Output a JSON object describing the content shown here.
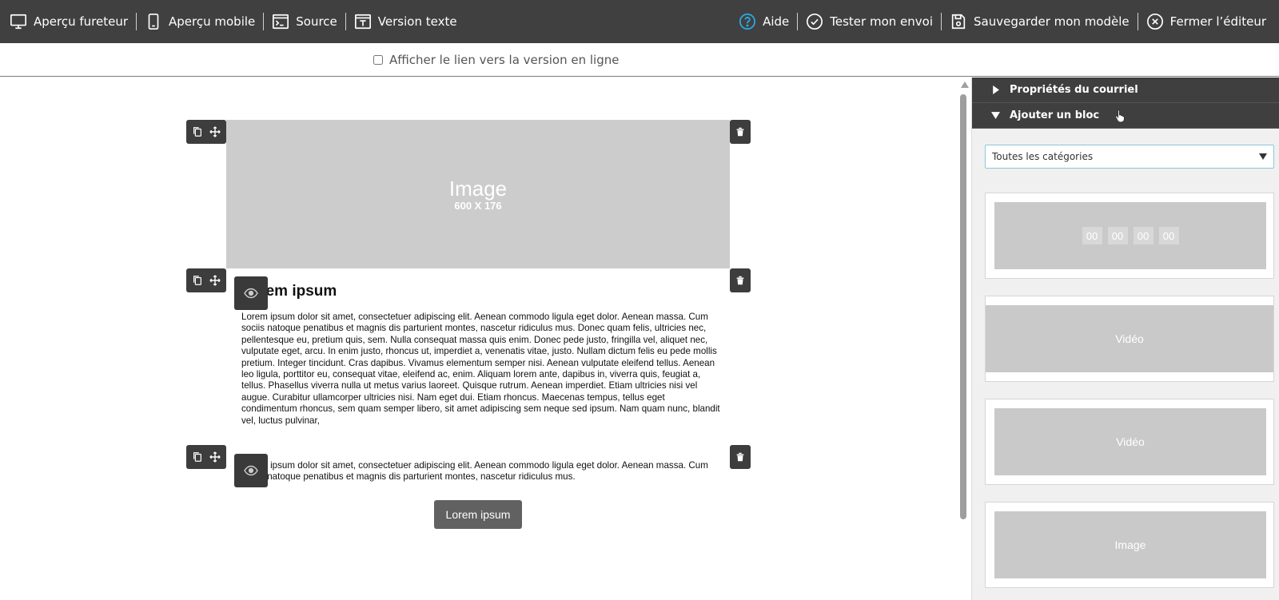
{
  "toolbar": {
    "left": [
      {
        "label": "Aperçu fureteur",
        "icon": "monitor-icon"
      },
      {
        "label": "Aperçu mobile",
        "icon": "mobile-icon"
      },
      {
        "label": "Source",
        "icon": "source-code-icon"
      },
      {
        "label": "Version texte",
        "icon": "text-version-icon"
      }
    ],
    "right": [
      {
        "label": "Aide",
        "icon": "help-icon",
        "icon_color": "#2aa8e0"
      },
      {
        "label": "Tester mon envoi",
        "icon": "check-circle-icon"
      },
      {
        "label": "Sauvegarder mon modèle",
        "icon": "save-icon"
      },
      {
        "label": "Fermer l’éditeur",
        "icon": "close-circle-icon"
      }
    ]
  },
  "subbar": {
    "online_link_label": "Afficher le lien vers la version en ligne",
    "online_link_checked": false
  },
  "editor": {
    "image_block": {
      "title": "Image",
      "size": "600 X 176"
    },
    "text_block": {
      "title": "Lorem ipsum",
      "body": "Lorem ipsum dolor sit amet, consectetuer adipiscing elit. Aenean commodo ligula eget dolor. Aenean massa. Cum sociis natoque penatibus et magnis dis parturient montes, nascetur ridiculus mus. Donec quam felis, ultricies nec, pellentesque eu, pretium quis, sem. Nulla consequat massa quis enim. Donec pede justo, fringilla vel, aliquet nec, vulputate eget, arcu. In enim justo, rhoncus ut, imperdiet a, venenatis vitae, justo. Nullam dictum felis eu pede mollis pretium. Integer tincidunt. Cras dapibus. Vivamus elementum semper nisi. Aenean vulputate eleifend tellus. Aenean leo ligula, porttitor eu, consequat vitae, eleifend ac, enim. Aliquam lorem ante, dapibus in, viverra quis, feugiat a, tellus. Phasellus viverra nulla ut metus varius laoreet. Quisque rutrum. Aenean imperdiet. Etiam ultricies nisi vel augue. Curabitur ullamcorper ultricies nisi. Nam eget dui. Etiam rhoncus. Maecenas tempus, tellus eget condimentum rhoncus, sem quam semper libero, sit amet adipiscing sem neque sed ipsum. Nam quam nunc, blandit vel, luctus pulvinar,"
    },
    "button_block": {
      "body": "Lorem ipsum dolor sit amet, consectetuer adipiscing elit. Aenean commodo ligula eget dolor. Aenean massa. Cum sociis natoque penatibus et magnis dis parturient montes, nascetur ridiculus mus.",
      "button_label": "Lorem ipsum"
    }
  },
  "panel": {
    "sections": [
      {
        "label": "Propriétés du courriel",
        "expanded": false
      },
      {
        "label": "Ajouter un bloc",
        "expanded": true
      }
    ],
    "category_select": {
      "value": "Toutes les catégories"
    },
    "tiles": [
      {
        "type": "countdown",
        "digits": [
          "00",
          "00",
          "00",
          "00"
        ]
      },
      {
        "type": "video",
        "label": "Vidéo"
      },
      {
        "type": "video",
        "label": "Vidéo"
      },
      {
        "type": "image",
        "label": "Image"
      }
    ]
  },
  "colors": {
    "toolbar_bg": "#404040",
    "panel_header_bg": "#3f3f3f",
    "placeholder_gray": "#cccccc",
    "cta_bg": "#616161",
    "help_blue": "#2aa8e0",
    "select_border": "#8ec7d9"
  }
}
